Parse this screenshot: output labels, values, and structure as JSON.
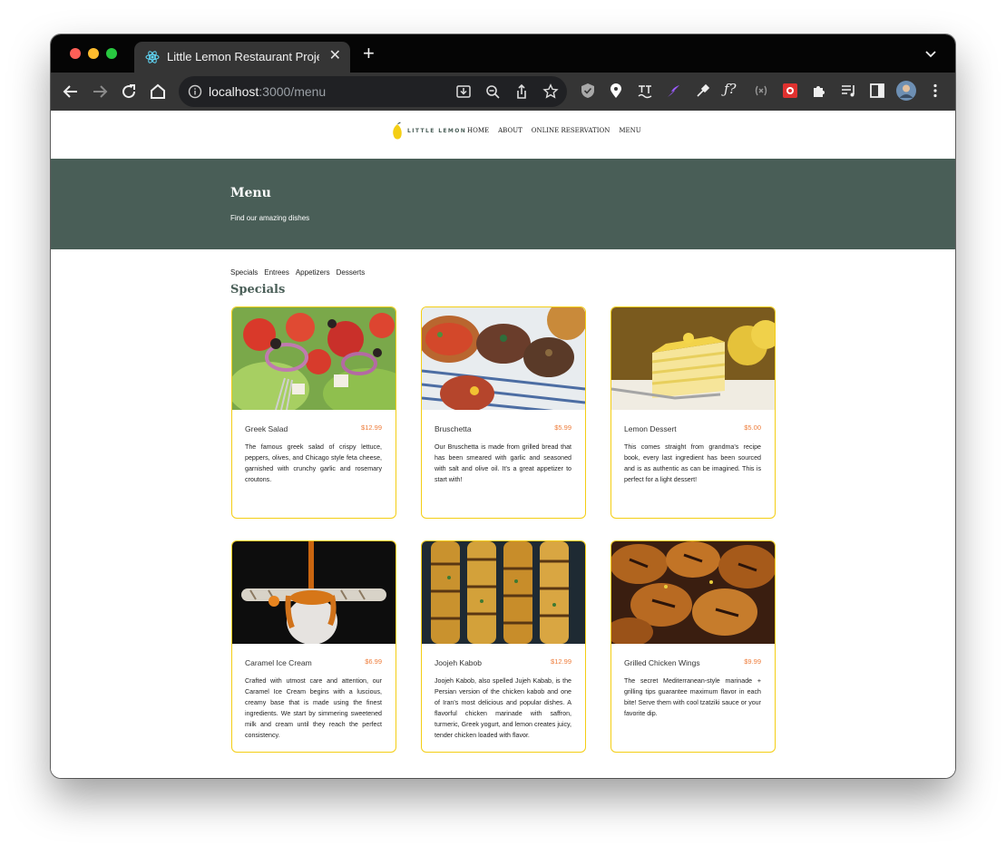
{
  "browser": {
    "tab_title": "Little Lemon Restaurant Project",
    "tab_close": "✕",
    "new_tab": "+",
    "url_host": "localhost",
    "url_path": ":3000/menu"
  },
  "site": {
    "logo_text": "LITTLE LEMON",
    "nav": [
      "HOME",
      "ABOUT",
      "ONLINE RESERVATION",
      "MENU"
    ],
    "hero": {
      "title": "Menu",
      "subtitle": "Find our amazing dishes"
    },
    "categories": [
      "Specials",
      "Entrees",
      "Appetizers",
      "Desserts"
    ],
    "section_title": "Specials"
  },
  "colors": {
    "primary_green": "#495e57",
    "accent_yellow": "#f4ce14",
    "price_orange": "#ee7c3a"
  },
  "dishes": [
    {
      "name": "Greek Salad",
      "price": "$12.99",
      "description": "The famous greek salad of crispy lettuce, peppers, olives, and Chicago style feta cheese, garnished with crunchy garlic and rosemary croutons.",
      "image": "greek-salad-photo"
    },
    {
      "name": "Bruschetta",
      "price": "$5.99",
      "description": "Our Bruschetta is made from grilled bread that has been smeared with garlic and seasoned with salt and olive oil. It's a great appetizer to start with!",
      "image": "bruschetta-photo"
    },
    {
      "name": "Lemon Dessert",
      "price": "$5.00",
      "description": "This comes straight from grandma's recipe book, every last ingredient has been sourced and is as authentic as can be imagined. This is perfect for a light dessert!",
      "image": "lemon-dessert-photo"
    },
    {
      "name": "Caramel Ice Cream",
      "price": "$6.99",
      "description": "Crafted with utmost care and attention, our Caramel Ice Cream begins with a luscious, creamy base that is made using the finest ingredients. We start by simmering sweetened milk and cream until they reach the perfect consistency.",
      "image": "caramel-ice-cream-photo"
    },
    {
      "name": "Joojeh Kabob",
      "price": "$12.99",
      "description": "Joojeh Kabob, also spelled Jujeh Kabab, is the Persian version of the chicken kabob and one of Iran's most delicious and popular dishes. A flavorful chicken marinade with saffron, turmeric, Greek yogurt, and lemon creates juicy, tender chicken loaded with flavor.",
      "image": "joojeh-kabob-photo"
    },
    {
      "name": "Grilled Chicken Wings",
      "price": "$9.99",
      "description": "The secret Mediterranean-style marinade + grilling tips guarantee maximum flavor in each bite! Serve them with cool tzatziki sauce or your favorite dip.",
      "image": "grilled-chicken-wings-photo"
    }
  ]
}
